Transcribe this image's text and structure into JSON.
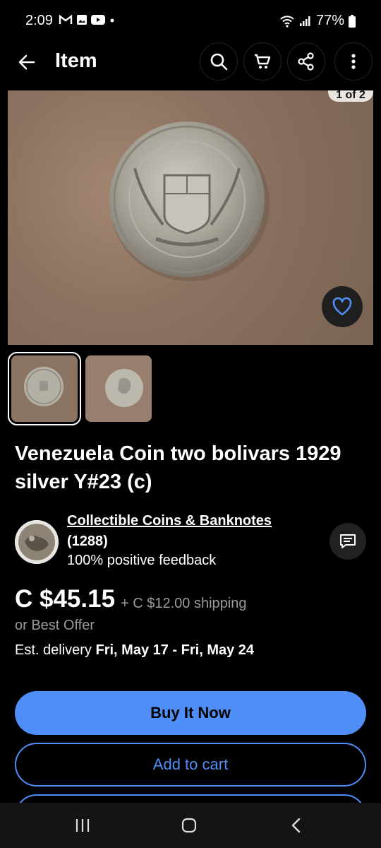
{
  "status": {
    "time": "2:09",
    "battery": "77%",
    "icons": [
      "gmail-icon",
      "gallery-icon",
      "youtube-icon",
      "dot-icon",
      "wifi-icon",
      "signal-icon",
      "battery-icon"
    ]
  },
  "appbar": {
    "title": "Item",
    "icons": [
      "back-arrow-icon",
      "search-icon",
      "cart-icon",
      "share-icon",
      "more-vertical-icon"
    ]
  },
  "gallery": {
    "counter": "1 of 2",
    "thumbnails": 2,
    "selected_index": 0
  },
  "listing": {
    "title": "Venezuela Coin two bolivars 1929 silver  Y#23 (c)"
  },
  "seller": {
    "name": "Collectible Coins & Banknotes",
    "count": "(1288)",
    "feedback": "100% positive feedback"
  },
  "pricing": {
    "price": "C $45.15",
    "shipping": "+ C $12.00 shipping",
    "offer": "or Best Offer",
    "delivery_label": "Est. delivery",
    "delivery_dates": "Fri, May 17 - Fri, May 24"
  },
  "actions": {
    "buy_now": "Buy It Now",
    "add_to_cart": "Add to cart"
  },
  "colors": {
    "accent": "#4f8ef7",
    "background": "#000000"
  }
}
